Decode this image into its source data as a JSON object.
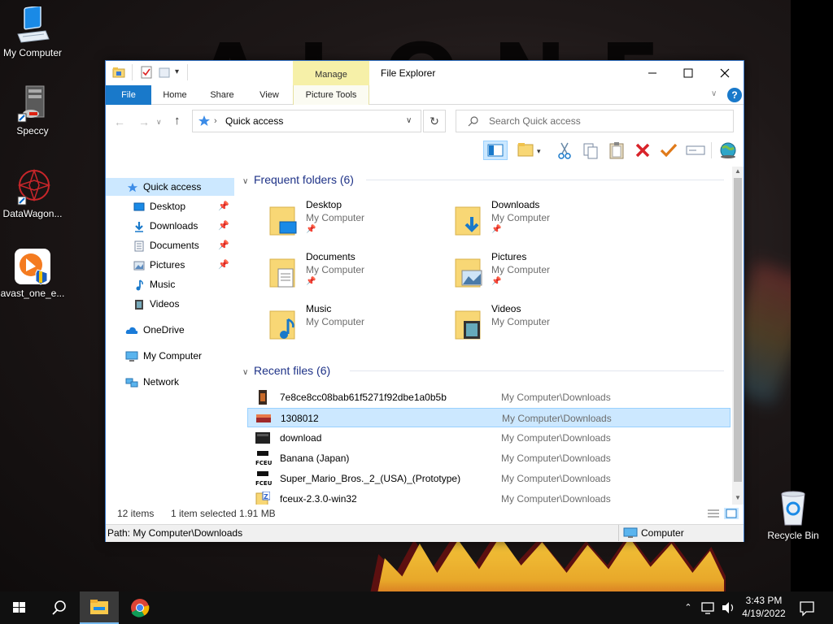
{
  "desktop": {
    "icons": [
      {
        "label": "My Computer"
      },
      {
        "label": "Speccy"
      },
      {
        "label": "DataWagon..."
      },
      {
        "label": "avast_one_e..."
      },
      {
        "label": "Recycle Bin"
      }
    ]
  },
  "window": {
    "title": "File Explorer",
    "contextual_tab_group": "Manage",
    "tabs": [
      "File",
      "Home",
      "Share",
      "View",
      "Picture Tools"
    ],
    "address": {
      "location": "Quick access",
      "search_placeholder": "Search Quick access"
    },
    "nav": {
      "items": [
        {
          "label": "Quick access",
          "icon": "star-icon"
        },
        {
          "label": "Desktop",
          "icon": "desktop-icon",
          "pinned": true
        },
        {
          "label": "Downloads",
          "icon": "download-arrow-icon",
          "pinned": true
        },
        {
          "label": "Documents",
          "icon": "document-icon",
          "pinned": true
        },
        {
          "label": "Pictures",
          "icon": "picture-icon",
          "pinned": true
        },
        {
          "label": "Music",
          "icon": "music-note-icon"
        },
        {
          "label": "Videos",
          "icon": "film-icon"
        },
        {
          "label": "OneDrive",
          "icon": "cloud-icon"
        },
        {
          "label": "My Computer",
          "icon": "monitor-icon"
        },
        {
          "label": "Network",
          "icon": "network-icon"
        }
      ]
    },
    "frequent": {
      "heading": "Frequent folders (6)",
      "folders": [
        {
          "name": "Desktop",
          "location": "My Computer",
          "pinned": true
        },
        {
          "name": "Downloads",
          "location": "My Computer",
          "pinned": true
        },
        {
          "name": "Documents",
          "location": "My Computer",
          "pinned": true
        },
        {
          "name": "Pictures",
          "location": "My Computer",
          "pinned": true
        },
        {
          "name": "Music",
          "location": "My Computer",
          "pinned": false
        },
        {
          "name": "Videos",
          "location": "My Computer",
          "pinned": false
        }
      ]
    },
    "recent": {
      "heading": "Recent files (6)",
      "files": [
        {
          "name": "7e8ce8cc08bab61f5271f92dbe1a0b5b",
          "location": "My Computer\\Downloads",
          "selected": false
        },
        {
          "name": "1308012",
          "location": "My Computer\\Downloads",
          "selected": true
        },
        {
          "name": "download",
          "location": "My Computer\\Downloads",
          "selected": false
        },
        {
          "name": "Banana (Japan)",
          "location": "My Computer\\Downloads",
          "selected": false
        },
        {
          "name": "Super_Mario_Bros._2_(USA)_(Prototype)",
          "location": "My Computer\\Downloads",
          "selected": false
        },
        {
          "name": "fceux-2.3.0-win32",
          "location": "My Computer\\Downloads",
          "selected": false
        }
      ]
    },
    "status": {
      "item_count": "12 items",
      "selection": "1 item selected",
      "size": "1.91 MB"
    },
    "pathbar": {
      "path": "Path: My Computer\\Downloads",
      "computer_label": "Computer"
    }
  },
  "taskbar": {
    "time": "3:43 PM",
    "date": "4/19/2022"
  },
  "colors": {
    "accent": "#0063b1",
    "selection": "#cce8ff",
    "section_heading": "#1e3287",
    "folder_yellow": "#f8d775"
  }
}
